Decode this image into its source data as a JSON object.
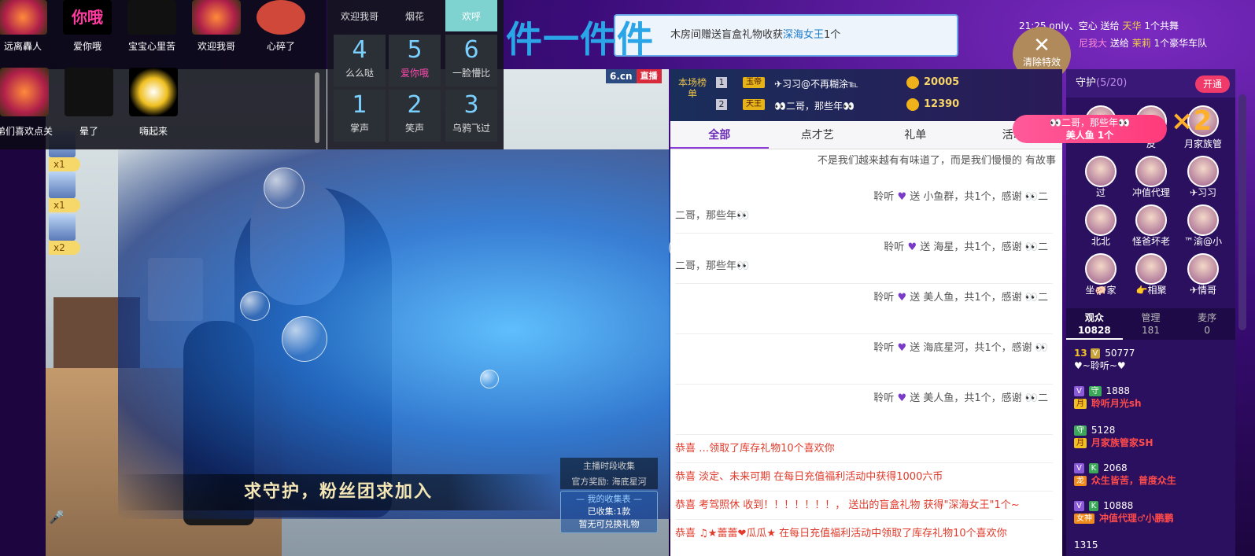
{
  "gift_grid": {
    "row1": [
      "远离轟人",
      "爱你哦",
      "宝宝心里苦",
      "欢迎我哥",
      "心碎了"
    ],
    "row1_art": [
      "你哦"
    ],
    "row2": [
      "弟们喜欢点关",
      "晕了",
      "嗨起来"
    ]
  },
  "keypad": {
    "row1": [
      {
        "label": "欢迎我哥"
      },
      {
        "label": "烟花"
      },
      {
        "label": "欢呼"
      }
    ],
    "row2": [
      {
        "num": "4",
        "label": "么么哒"
      },
      {
        "num": "5",
        "label": "爱你哦"
      },
      {
        "num": "6",
        "label": "一脸懵比"
      }
    ],
    "row3": [
      {
        "num": "1",
        "label": "掌声"
      },
      {
        "num": "2",
        "label": "笑声"
      },
      {
        "num": "3",
        "label": "乌鸦飞过"
      }
    ]
  },
  "big_title": "件一件件",
  "ticker": {
    "pre": "木房间赠送盲盒礼物收获",
    "gift": "深海女王",
    "post": "1个"
  },
  "top_right": {
    "time": "21:25",
    "line1_name": "only、空心",
    "line1_sep": "送给",
    "line1_to": "天华",
    "line1_tail": "1个共舞",
    "line2_name": "尼我大",
    "line2_sep": "送给",
    "line2_to": "茉莉",
    "line2_tail": "1个豪华车队"
  },
  "clear_fx": {
    "icon": "close-icon",
    "label": "清除特效"
  },
  "gift_popup": {
    "name": "👀二哥，那些年👀",
    "gift": "美人鱼 1个",
    "multiplier": "×2"
  },
  "brand": {
    "name": "6.cn",
    "tag": "直播"
  },
  "rank": {
    "label": "本场榜单",
    "rows": [
      {
        "no": "1",
        "level": "玉帝",
        "name": "✈习习@不再糊涂℡",
        "score": "20005"
      },
      {
        "no": "2",
        "level": "天王",
        "name": "👀二哥，那些年👀",
        "score": "12390"
      }
    ]
  },
  "chat": {
    "tabs": [
      "全部",
      "点才艺",
      "礼单",
      "活动"
    ],
    "active_tab": "全部",
    "top_line": "不是我们越来越有有味道了，而是我们慢慢的 有故事",
    "gifts": [
      {
        "pre": "聆听",
        "heart": "♥",
        "send": "送",
        "gift": "小鱼群，共1个，感谢 👀二",
        "tail": "二哥，那些年👀"
      },
      {
        "pre": "聆听",
        "heart": "♥",
        "send": "送",
        "gift": "海星，共1个，感谢 👀二",
        "tail": "二哥，那些年👀"
      },
      {
        "pre": "聆听",
        "heart": "♥",
        "send": "送",
        "gift": "美人鱼，共1个，感谢 👀二",
        "tail": ""
      },
      {
        "pre": "聆听",
        "heart": "♥",
        "send": "送",
        "gift": "海底星河，共1个，感谢 👀",
        "tail": ""
      },
      {
        "pre": "聆听",
        "heart": "♥",
        "send": "送",
        "gift": "美人鱼，共1个，感谢 👀二",
        "tail": ""
      }
    ],
    "sys": [
      "恭喜 …领取了库存礼物10个喜欢你",
      "恭喜 淡定、未来可期 在每日充值福利活动中获得1000六币",
      "恭喜 考驾照休 收到！！！！！！！， 送出的盲盒礼物 获得\"深海女王\"1个~",
      "恭喜 ♫★蕾蕾❤瓜瓜★ 在每日充值福利活动中领取了库存礼物10个喜欢你"
    ],
    "sys_prefix": "恭喜"
  },
  "guard": {
    "title": "守护",
    "count": "(5/20)",
    "open": "开通",
    "row0": [
      "",
      "皮",
      "月家族管"
    ],
    "row1": [
      "过",
      "冲值代理",
      "✈习习"
    ],
    "row2": [
      "北北",
      "怪爸坏老",
      "™渝@小"
    ],
    "row3": [
      "坐🐖家",
      "👉相聚",
      "✈情哥"
    ]
  },
  "audience": {
    "tabs": [
      {
        "label": "观众",
        "count": "10828"
      },
      {
        "label": "管理",
        "count": "181"
      },
      {
        "label": "麦序",
        "count": "0"
      }
    ],
    "rows": [
      {
        "lv": "13",
        "coin": "50777",
        "name": "♥~聆听~♥",
        "tag": "",
        "b1": "V",
        "b2": ""
      },
      {
        "lv": "",
        "coin": "1888",
        "name": "聆听月光sh",
        "tag": "月",
        "b1": "V",
        "b2": "守"
      },
      {
        "lv": "",
        "coin": "5128",
        "name": "月家族管家SH",
        "tag": "月",
        "b1": "",
        "b2": "守"
      },
      {
        "lv": "",
        "coin": "2068",
        "name": "众生皆苦，普度众生",
        "tag": "龙",
        "b1": "V",
        "b2": "K"
      },
      {
        "lv": "",
        "coin": "10888",
        "name": "冲值代理♂小鹏鹏",
        "tag": "女神",
        "b1": "V",
        "b2": "K"
      },
      {
        "lv": "",
        "coin": "1315",
        "name": "",
        "tag": "",
        "b1": "",
        "b2": ""
      }
    ]
  },
  "left_gifters": [
    {
      "count": "x1"
    },
    {
      "count": "x1"
    },
    {
      "count": "x2"
    }
  ],
  "banner": "求守护，粉丝团求加入",
  "collect": {
    "line1": "主播时段收集",
    "line2": "官方奖励: 海底星河",
    "title": "— 我的收集表 —",
    "got": "已收集:1款",
    "none": "暂无可兑换礼物"
  }
}
